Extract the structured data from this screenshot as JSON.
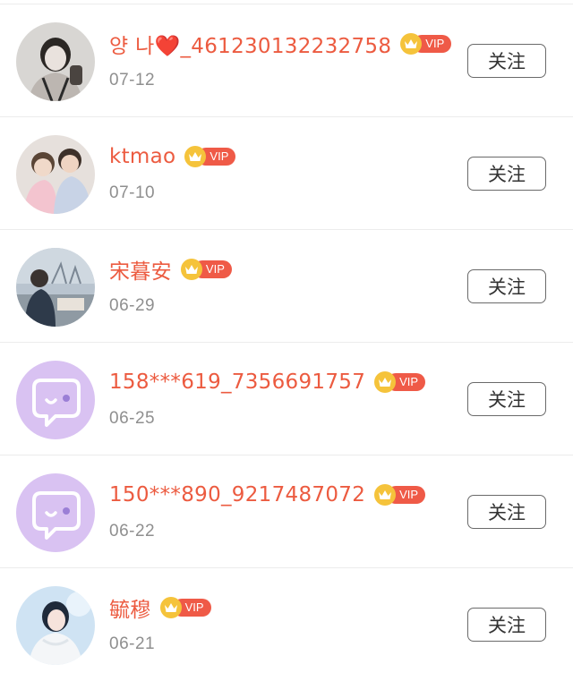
{
  "followers": [
    {
      "name": "양 나❤️_461230132232758",
      "date": "07-12",
      "avatar": "photo-girl-bw",
      "follow_label": "关注"
    },
    {
      "name": "ktmao",
      "date": "07-10",
      "avatar": "photo-couple",
      "follow_label": "关注"
    },
    {
      "name": "宋暮安",
      "date": "06-29",
      "avatar": "photo-outdoor",
      "follow_label": "关注"
    },
    {
      "name": "158***619_7356691757",
      "date": "06-25",
      "avatar": "default-chat-bubble",
      "follow_label": "关注"
    },
    {
      "name": "150***890_9217487072",
      "date": "06-22",
      "avatar": "default-chat-bubble",
      "follow_label": "关注"
    },
    {
      "name": "毓穆",
      "date": "06-21",
      "avatar": "photo-girl-blue",
      "follow_label": "关注"
    }
  ],
  "vip_badge": "VIP",
  "colors": {
    "name": "#ec5b40",
    "vip_crown": "#f5c33b",
    "vip_label": "#ef5a47",
    "default_avatar": "#d9c2f2"
  }
}
